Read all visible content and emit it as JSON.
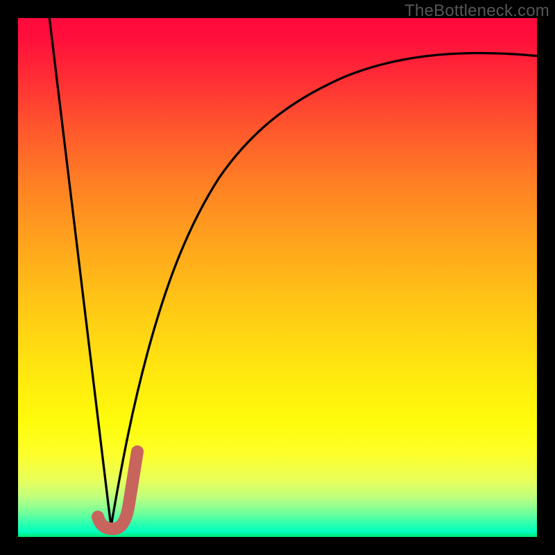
{
  "watermark": "TheBottleneck.com",
  "chart_data": {
    "type": "line",
    "title": "",
    "xlabel": "",
    "ylabel": "",
    "xlim": [
      0,
      100
    ],
    "ylim": [
      0,
      100
    ],
    "grid": false,
    "legend": false,
    "series": [
      {
        "name": "left-descending-line",
        "color": "#000000",
        "x": [
          6,
          18
        ],
        "values": [
          100,
          2
        ]
      },
      {
        "name": "right-rising-curve",
        "color": "#000000",
        "x": [
          18,
          22,
          26,
          30,
          35,
          40,
          46,
          54,
          64,
          78,
          90,
          100
        ],
        "values": [
          2,
          20,
          35,
          47,
          58,
          66,
          73,
          79,
          84,
          88,
          90,
          91
        ]
      },
      {
        "name": "marker-j",
        "color": "#c8645e",
        "x": [
          15,
          18,
          20,
          22
        ],
        "values": [
          4,
          2,
          7,
          16
        ]
      }
    ],
    "gradient_stops": [
      {
        "pos": 0,
        "color": "#ff093c"
      },
      {
        "pos": 50,
        "color": "#ffc915"
      },
      {
        "pos": 90,
        "color": "#e9ff59"
      },
      {
        "pos": 100,
        "color": "#00e66f"
      }
    ]
  }
}
